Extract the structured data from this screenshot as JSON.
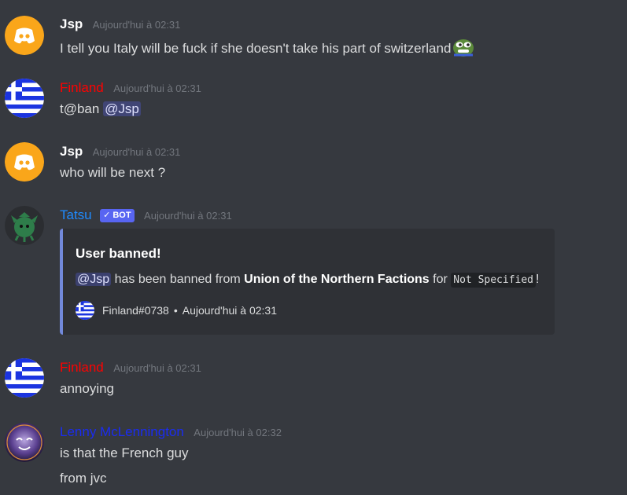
{
  "messages": [
    {
      "author": "Jsp",
      "timestamp": "Aujourd'hui à 02:31",
      "text": "I tell you Italy will be fuck if she doesn't take his part of switzerland",
      "avatar": "discord-logo-orange",
      "emoji": "pepe-emoji"
    },
    {
      "author": "Finland",
      "timestamp": "Aujourd'hui à 02:31",
      "text_prefix": "t@ban",
      "mention": "@Jsp",
      "avatar": "greek-flag"
    },
    {
      "author": "Jsp",
      "timestamp": "Aujourd'hui à 02:31",
      "text": "who will be next ?",
      "avatar": "discord-logo-orange"
    },
    {
      "author": "Tatsu",
      "bot_tag": "✓ BOT",
      "timestamp": "Aujourd'hui à 02:31",
      "avatar": "tatsu-avatar",
      "embed": {
        "title": "User banned!",
        "mention": "@Jsp",
        "text_1": " has been banned from ",
        "server": "Union of the Northern Factions",
        "text_2": " for ",
        "reason": "Not Specified",
        "text_3": "!",
        "footer_user": "Finland#0738",
        "footer_sep": "•",
        "footer_time": "Aujourd'hui à 02:31",
        "accent_color": "#7289da"
      }
    },
    {
      "author": "Finland",
      "timestamp": "Aujourd'hui à 02:31",
      "text": "annoying",
      "avatar": "greek-flag"
    },
    {
      "author": "Lenny McLennington",
      "timestamp": "Aujourd'hui à 02:32",
      "text": "is that the French guy",
      "text_2": "from jvc",
      "avatar": "lenny-avatar"
    }
  ],
  "colors": {
    "background": "#36393f",
    "finland_name": "#ff0000",
    "tatsu_name": "#1f8bff",
    "lenny_name": "#1a2cf0",
    "discord_orange": "#faa61a",
    "bot_tag": "#5865f2"
  }
}
